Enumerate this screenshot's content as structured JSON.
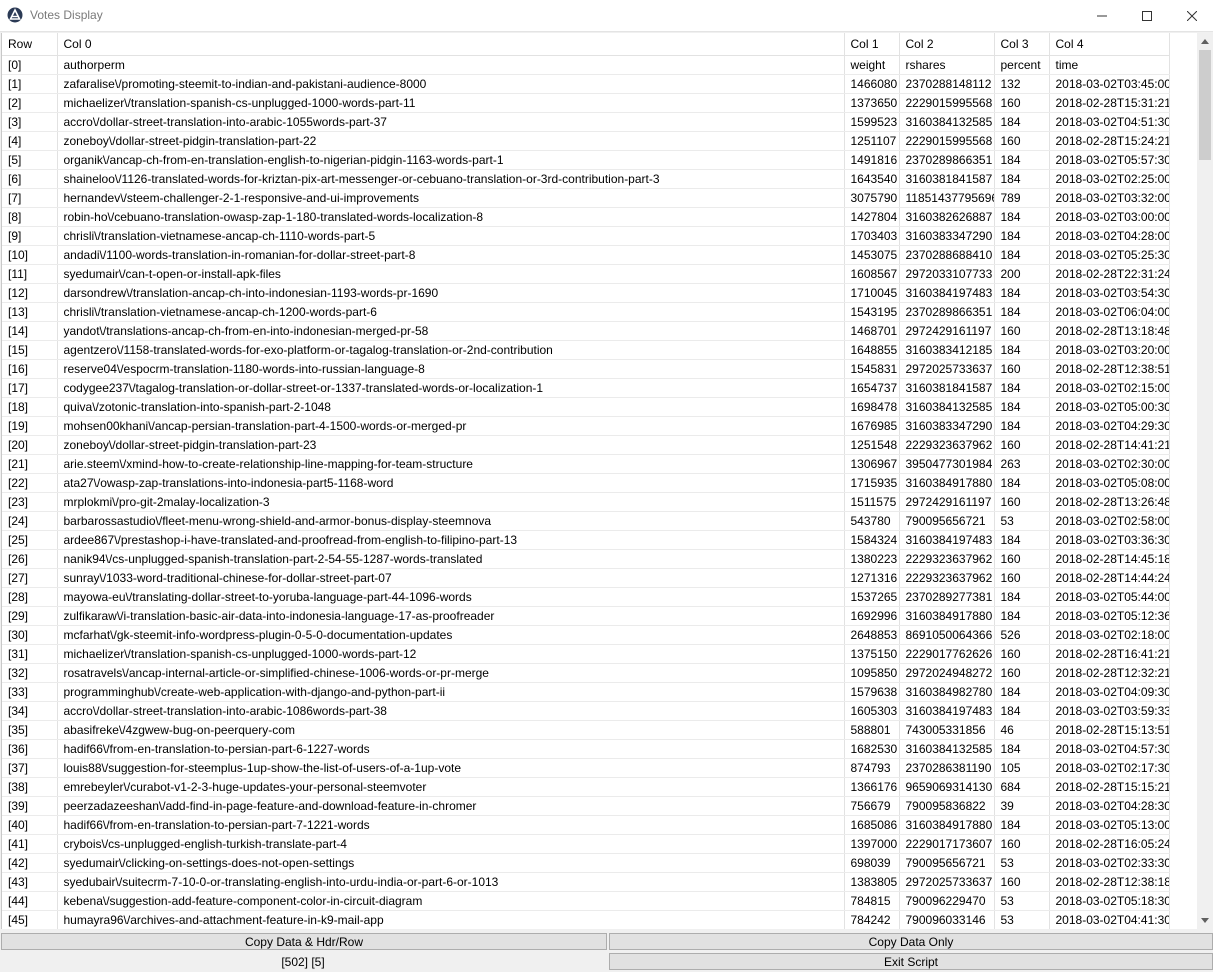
{
  "window": {
    "title": "Votes Display"
  },
  "table": {
    "headers": [
      "Row",
      "Col 0",
      "Col 1",
      "Col 2",
      "Col 3",
      "Col 4"
    ],
    "rows": [
      [
        "[0]",
        "authorperm",
        "weight",
        "rshares",
        "percent",
        "time"
      ],
      [
        "[1]",
        "zafaralise\\/promoting-steemit-to-indian-and-pakistani-audience-8000",
        "1466080",
        "2370288148112",
        "132",
        "2018-03-02T03:45:00"
      ],
      [
        "[2]",
        "michaelizer\\/translation-spanish-cs-unplugged-1000-words-part-11",
        "1373650",
        "2229015995568",
        "160",
        "2018-02-28T15:31:21"
      ],
      [
        "[3]",
        "accro\\/dollar-street-translation-into-arabic-1055words-part-37",
        "1599523",
        "3160384132585",
        "184",
        "2018-03-02T04:51:30"
      ],
      [
        "[4]",
        "zoneboy\\/dollar-street-pidgin-translation-part-22",
        "1251107",
        "2229015995568",
        "160",
        "2018-02-28T15:24:21"
      ],
      [
        "[5]",
        "organik\\/ancap-ch-from-en-translation-english-to-nigerian-pidgin-1163-words-part-1",
        "1491816",
        "2370289866351",
        "184",
        "2018-03-02T05:57:30"
      ],
      [
        "[6]",
        "shaineloo\\/1126-translated-words-for-kriztan-pix-art-messenger-or-cebuano-translation-or-3rd-contribution-part-3",
        "1643540",
        "3160381841587",
        "184",
        "2018-03-02T02:25:00"
      ],
      [
        "[7]",
        "hernandev\\/steem-challenger-2-1-responsive-and-ui-improvements",
        "3075790",
        "11851437795696",
        "789",
        "2018-03-02T03:32:00"
      ],
      [
        "[8]",
        "robin-ho\\/cebuano-translation-owasp-zap-1-180-translated-words-localization-8",
        "1427804",
        "3160382626887",
        "184",
        "2018-03-02T03:00:00"
      ],
      [
        "[9]",
        "chrisli\\/translation-vietnamese-ancap-ch-1110-words-part-5",
        "1703403",
        "3160383347290",
        "184",
        "2018-03-02T04:28:00"
      ],
      [
        "[10]",
        "andadi\\/1100-words-translation-in-romanian-for-dollar-street-part-8",
        "1453075",
        "2370288688410",
        "184",
        "2018-03-02T05:25:30"
      ],
      [
        "[11]",
        "syedumair\\/can-t-open-or-install-apk-files",
        "1608567",
        "2972033107733",
        "200",
        "2018-02-28T22:31:24"
      ],
      [
        "[12]",
        "darsondrew\\/translation-ancap-ch-into-indonesian-1193-words-pr-1690",
        "1710045",
        "3160384197483",
        "184",
        "2018-03-02T03:54:30"
      ],
      [
        "[13]",
        "chrisli\\/translation-vietnamese-ancap-ch-1200-words-part-6",
        "1543195",
        "2370289866351",
        "184",
        "2018-03-02T06:04:00"
      ],
      [
        "[14]",
        "yandot\\/translations-ancap-ch-from-en-into-indonesian-merged-pr-58",
        "1468701",
        "2972429161197",
        "160",
        "2018-02-28T13:18:48"
      ],
      [
        "[15]",
        "agentzero\\/1158-translated-words-for-exo-platform-or-tagalog-translation-or-2nd-contribution",
        "1648855",
        "3160383412185",
        "184",
        "2018-03-02T03:20:00"
      ],
      [
        "[16]",
        "reserve04\\/espocrm-translation-1180-words-into-russian-language-8",
        "1545831",
        "2972025733637",
        "160",
        "2018-02-28T12:38:51"
      ],
      [
        "[17]",
        "codygee237\\/tagalog-translation-or-dollar-street-or-1337-translated-words-or-localization-1",
        "1654737",
        "3160381841587",
        "184",
        "2018-03-02T02:15:00"
      ],
      [
        "[18]",
        "quiva\\/zotonic-translation-into-spanish-part-2-1048",
        "1698478",
        "3160384132585",
        "184",
        "2018-03-02T05:00:30"
      ],
      [
        "[19]",
        "mohsen00khani\\/ancap-persian-translation-part-4-1500-words-or-merged-pr",
        "1676985",
        "3160383347290",
        "184",
        "2018-03-02T04:29:30"
      ],
      [
        "[20]",
        "zoneboy\\/dollar-street-pidgin-translation-part-23",
        "1251548",
        "2229323637962",
        "160",
        "2018-02-28T14:41:21"
      ],
      [
        "[21]",
        "arie.steem\\/xmind-how-to-create-relationship-line-mapping-for-team-structure",
        "1306967",
        "3950477301984",
        "263",
        "2018-03-02T02:30:00"
      ],
      [
        "[22]",
        "ata27\\/owasp-zap-translations-into-indonesia-part5-1168-word",
        "1715935",
        "3160384917880",
        "184",
        "2018-03-02T05:08:00"
      ],
      [
        "[23]",
        "mrplokmi\\/pro-git-2malay-localization-3",
        "1511575",
        "2972429161197",
        "160",
        "2018-02-28T13:26:48"
      ],
      [
        "[24]",
        "barbarossastudio\\/fleet-menu-wrong-shield-and-armor-bonus-display-steemnova",
        "543780",
        "790095656721",
        "53",
        "2018-03-02T02:58:00"
      ],
      [
        "[25]",
        "ardee867\\/prestashop-i-have-translated-and-proofread-from-english-to-filipino-part-13",
        "1584324",
        "3160384197483",
        "184",
        "2018-03-02T03:36:30"
      ],
      [
        "[26]",
        "nanik94\\/cs-unplugged-spanish-translation-part-2-54-55-1287-words-translated",
        "1380223",
        "2229323637962",
        "160",
        "2018-02-28T14:45:18"
      ],
      [
        "[27]",
        "sunray\\/1033-word-traditional-chinese-for-dollar-street-part-07",
        "1271316",
        "2229323637962",
        "160",
        "2018-02-28T14:44:24"
      ],
      [
        "[28]",
        "mayowa-eu\\/translating-dollar-street-to-yoruba-language-part-44-1096-words",
        "1537265",
        "2370289277381",
        "184",
        "2018-03-02T05:44:00"
      ],
      [
        "[29]",
        "zulfikaraw\\/i-translation-basic-air-data-into-indonesia-language-17-as-proofreader",
        "1692996",
        "3160384917880",
        "184",
        "2018-03-02T05:12:36"
      ],
      [
        "[30]",
        "mcfarhat\\/gk-steemit-info-wordpress-plugin-0-5-0-documentation-updates",
        "2648853",
        "8691050064366",
        "526",
        "2018-03-02T02:18:00"
      ],
      [
        "[31]",
        "michaelizer\\/translation-spanish-cs-unplugged-1000-words-part-12",
        "1375150",
        "2229017762626",
        "160",
        "2018-02-28T16:41:21"
      ],
      [
        "[32]",
        "rosatravels\\/ancap-internal-article-or-simplified-chinese-1006-words-or-pr-merge",
        "1095850",
        "2972024948272",
        "160",
        "2018-02-28T12:32:21"
      ],
      [
        "[33]",
        "programminghub\\/create-web-application-with-django-and-python-part-ii",
        "1579638",
        "3160384982780",
        "184",
        "2018-03-02T04:09:30"
      ],
      [
        "[34]",
        "accro\\/dollar-street-translation-into-arabic-1086words-part-38",
        "1605303",
        "3160384197483",
        "184",
        "2018-03-02T03:59:33"
      ],
      [
        "[35]",
        "abasifreke\\/4zgwew-bug-on-peerquery-com",
        "588801",
        "743005331856",
        "46",
        "2018-02-28T15:13:51"
      ],
      [
        "[36]",
        "hadif66\\/from-en-translation-to-persian-part-6-1227-words",
        "1682530",
        "3160384132585",
        "184",
        "2018-03-02T04:57:30"
      ],
      [
        "[37]",
        "louis88\\/suggestion-for-steemplus-1up-show-the-list-of-users-of-a-1up-vote",
        "874793",
        "2370286381190",
        "105",
        "2018-03-02T02:17:30"
      ],
      [
        "[38]",
        "emrebeyler\\/curabot-v1-2-3-huge-updates-your-personal-steemvoter",
        "1366176",
        "9659069314130",
        "684",
        "2018-02-28T15:15:21"
      ],
      [
        "[39]",
        "peerzadazeeshan\\/add-find-in-page-feature-and-download-feature-in-chromer",
        "756679",
        "790095836822",
        "39",
        "2018-03-02T04:28:30"
      ],
      [
        "[40]",
        "hadif66\\/from-en-translation-to-persian-part-7-1221-words",
        "1685086",
        "3160384917880",
        "184",
        "2018-03-02T05:13:00"
      ],
      [
        "[41]",
        "crybois\\/cs-unplugged-english-turkish-translate-part-4",
        "1397000",
        "2229017173607",
        "160",
        "2018-02-28T16:05:24"
      ],
      [
        "[42]",
        "syedumair\\/clicking-on-settings-does-not-open-settings",
        "698039",
        "790095656721",
        "53",
        "2018-03-02T02:33:30"
      ],
      [
        "[43]",
        "syedubair\\/suitecrm-7-10-0-or-translating-english-into-urdu-india-or-part-6-or-1013",
        "1383805",
        "2972025733637",
        "160",
        "2018-02-28T12:38:18"
      ],
      [
        "[44]",
        "kebena\\/suggestion-add-feature-component-color-in-circuit-diagram",
        "784815",
        "790096229470",
        "53",
        "2018-03-02T05:18:30"
      ],
      [
        "[45]",
        "humayra96\\/archives-and-attachment-feature-in-k9-mail-app",
        "784242",
        "790096033146",
        "53",
        "2018-03-02T04:41:30"
      ]
    ]
  },
  "buttons": {
    "copy_all": "Copy Data & Hdr/Row",
    "copy_data": "Copy Data Only",
    "exit": "Exit Script"
  },
  "status": {
    "dims": "[502] [5]"
  },
  "icons": {
    "app": "app-logo-icon",
    "minimize": "minimize-icon",
    "maximize": "maximize-icon",
    "close": "close-icon"
  }
}
